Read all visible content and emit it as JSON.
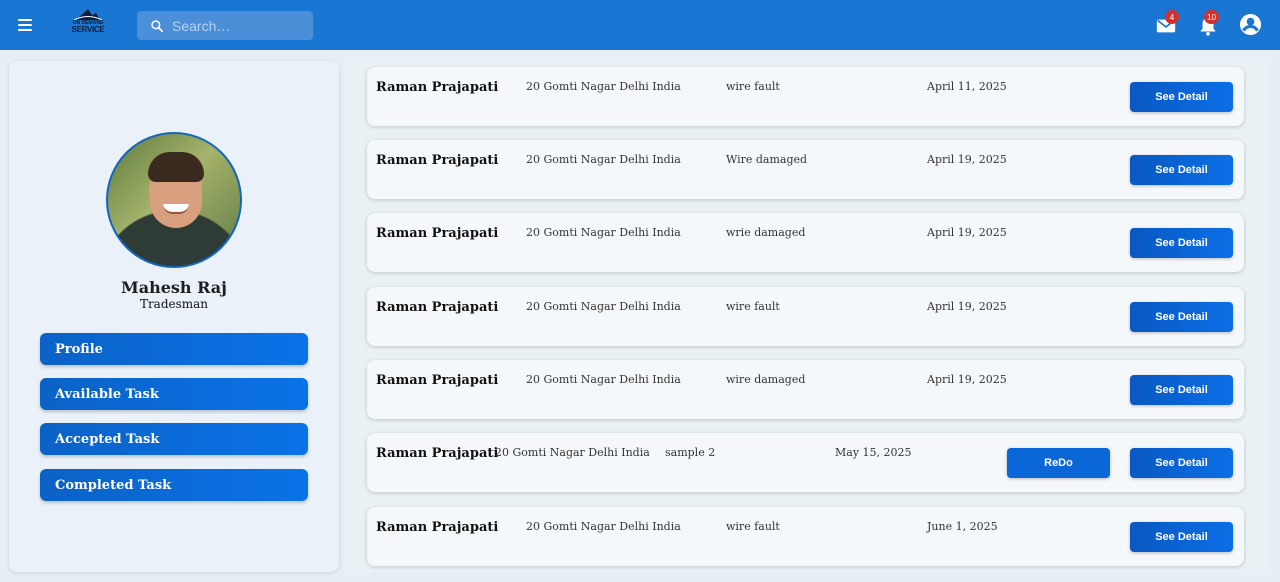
{
  "header": {
    "logo_line1": "ON DEMAND",
    "logo_line2": "SERVICE",
    "search_placeholder": "Search…",
    "mail_badge": "4",
    "notification_badge": "10",
    "icons": [
      "menu-icon",
      "search-icon",
      "mail-icon",
      "bell-icon",
      "account-icon"
    ]
  },
  "profile": {
    "name": "Mahesh Raj",
    "role": "Tradesman"
  },
  "nav": [
    {
      "label": "Profile"
    },
    {
      "label": "Available Task"
    },
    {
      "label": "Accepted Task"
    },
    {
      "label": "Completed Task"
    }
  ],
  "tasks": [
    {
      "name": "Raman Prajapati",
      "address": "20 Gomti Nagar Delhi India",
      "issue": "wire fault",
      "date": "April 11, 2025",
      "detail_label": "See Detail"
    },
    {
      "name": "Raman Prajapati",
      "address": "20 Gomti Nagar Delhi India",
      "issue": "Wire damaged",
      "date": "April 19, 2025",
      "detail_label": "See Detail"
    },
    {
      "name": "Raman Prajapati",
      "address": "20 Gomti Nagar Delhi India",
      "issue": "wrie damaged",
      "date": "April 19, 2025",
      "detail_label": "See Detail"
    },
    {
      "name": "Raman Prajapati",
      "address": "20 Gomti Nagar Delhi India",
      "issue": "wire fault",
      "date": "April 19, 2025",
      "detail_label": "See Detail"
    },
    {
      "name": "Raman Prajapati",
      "address": "20 Gomti Nagar Delhi India",
      "issue": "wire damaged",
      "date": "April 19, 2025",
      "detail_label": "See Detail"
    },
    {
      "name": "Raman Prajapati",
      "address": "20 Gomti Nagar Delhi India",
      "issue": "sample 2",
      "date": "May 15, 2025",
      "redo_label": "ReDo",
      "detail_label": "See Detail"
    },
    {
      "name": "Raman Prajapati",
      "address": "20 Gomti Nagar Delhi India",
      "issue": "wire fault",
      "date": "June 1, 2025",
      "detail_label": "See Detail"
    }
  ],
  "colors": {
    "appbar": "#1976d2",
    "button": "#0b6fe6",
    "badge": "#d32f2f"
  }
}
